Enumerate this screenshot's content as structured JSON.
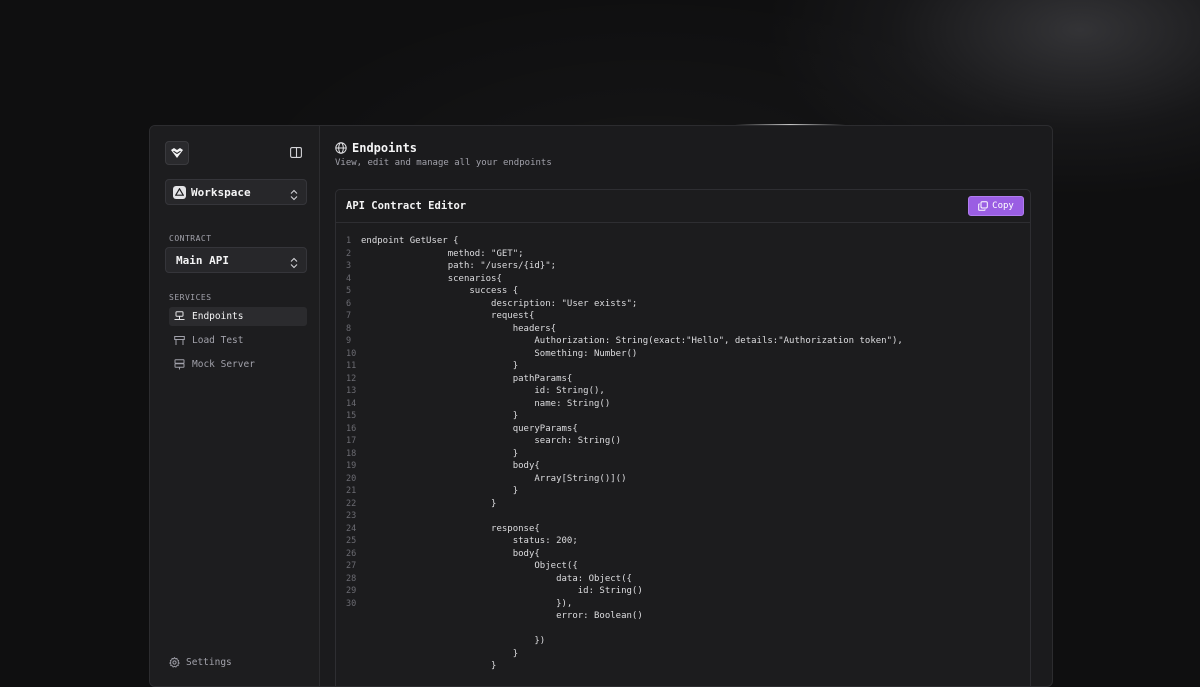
{
  "sidebar": {
    "workspace_label": "Workspace",
    "contract_section": "CONTRACT",
    "contract_value": "Main API",
    "services_section": "SERVICES",
    "items": [
      {
        "label": "Endpoints",
        "icon": "network-icon"
      },
      {
        "label": "Load Test",
        "icon": "load-test-icon"
      },
      {
        "label": "Mock Server",
        "icon": "server-icon"
      }
    ],
    "settings_label": "Settings"
  },
  "header": {
    "title": "Endpoints",
    "subtitle": "View, edit and manage all your endpoints"
  },
  "editor": {
    "title": "API Contract Editor",
    "copy_label": "Copy",
    "accent_color": "#9a5ee3",
    "line_numbers": [
      "1",
      "2",
      "3",
      "4",
      "5",
      "6",
      "7",
      "8",
      "9",
      "10",
      "11",
      "12",
      "13",
      "14",
      "15",
      "16",
      "17",
      "18",
      "19",
      "20",
      "21",
      "22",
      "23",
      "24",
      "25",
      "26",
      "27",
      "28",
      "29",
      "30"
    ],
    "code_lines": [
      "endpoint GetUser {",
      "                method: \"GET\";",
      "                path: \"/users/{id}\";",
      "                scenarios{",
      "                    success {",
      "                        description: \"User exists\";",
      "                        request{",
      "                            headers{",
      "                                Authorization: String(exact:\"Hello\", details:\"Authorization token\"),",
      "                                Something: Number()",
      "                            }",
      "                            pathParams{",
      "                                id: String(),",
      "                                name: String()",
      "                            }",
      "                            queryParams{",
      "                                search: String()",
      "                            }",
      "                            body{",
      "                                Array[String()]()",
      "                            }",
      "                        }",
      "",
      "                        response{",
      "                            status: 200;",
      "                            body{",
      "                                Object({",
      "                                    data: Object({",
      "                                        id: String()",
      "                                    }),",
      "                                    error: Boolean()",
      "",
      "                                })",
      "                            }",
      "                        }"
    ]
  }
}
